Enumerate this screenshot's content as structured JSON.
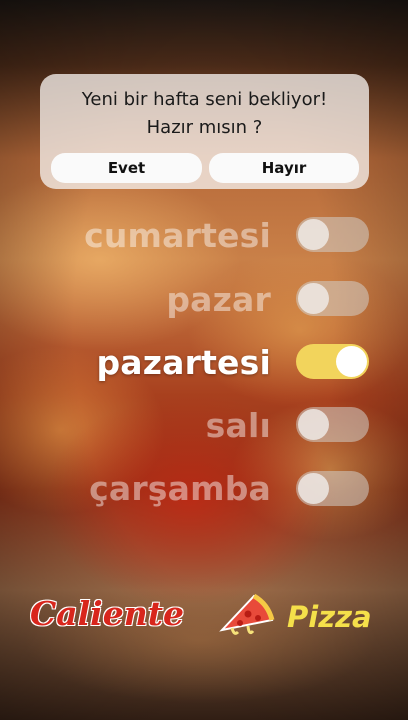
{
  "dialog": {
    "line1": "Yeni bir hafta seni bekliyor!",
    "line2": "Hazır mısın ?",
    "yes_label": "Evet",
    "no_label": "Hayır"
  },
  "days": [
    {
      "label": "cumartesi",
      "enabled": false
    },
    {
      "label": "pazar",
      "enabled": false
    },
    {
      "label": "pazartesi",
      "enabled": true
    },
    {
      "label": "salı",
      "enabled": false
    },
    {
      "label": "çarşamba",
      "enabled": false
    }
  ],
  "logo": {
    "brand_left": "Caliente",
    "brand_right": "Pizza",
    "icon": "pizza-slice-icon",
    "colors": {
      "red": "#d8261c",
      "yellow": "#f5e04a"
    }
  },
  "colors": {
    "toggle_on": "#f2d45c"
  }
}
